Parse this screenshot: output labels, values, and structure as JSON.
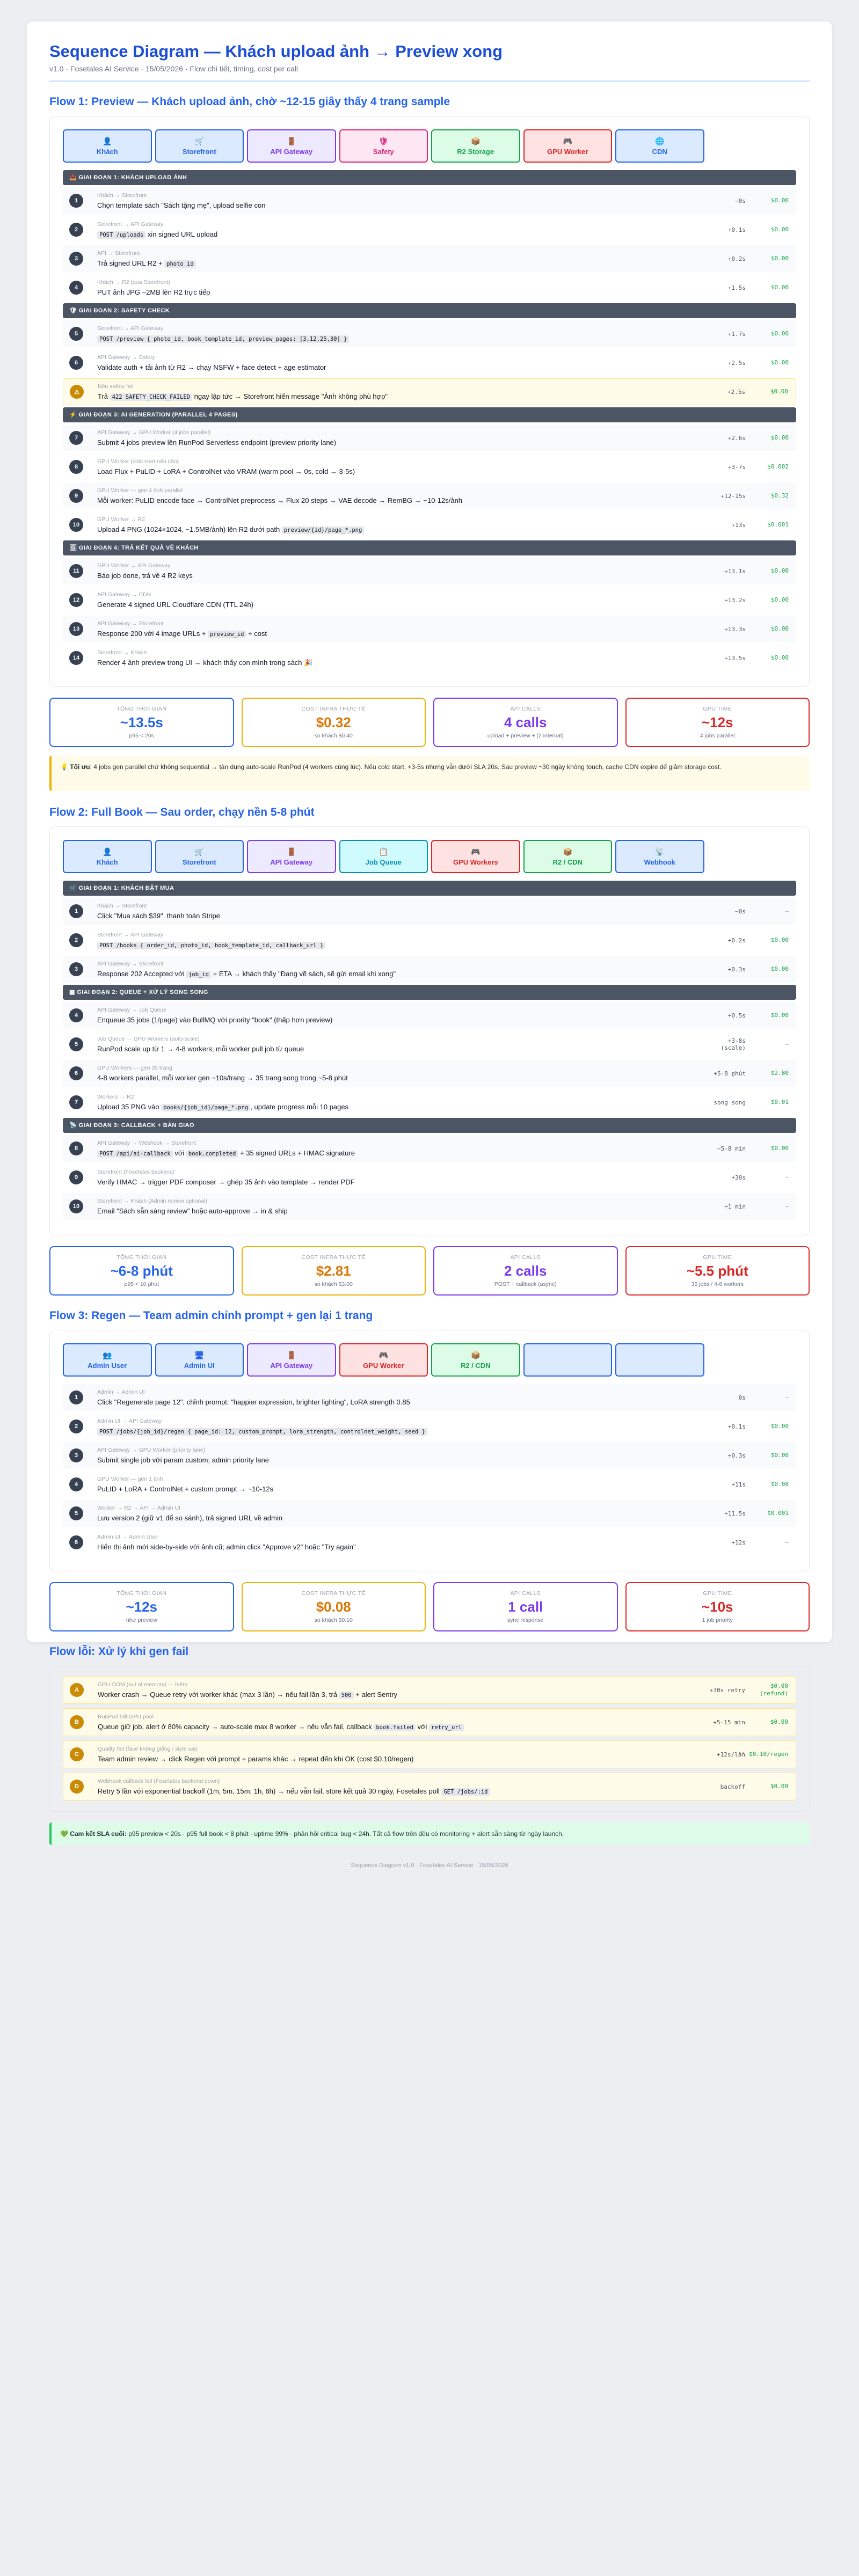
{
  "header": {
    "title": "Sequence Diagram — Khách upload ảnh → Preview xong",
    "meta": "v1.0 · Fosetales AI Service · 15/05/2026 · Flow chi tiết, timing, cost per call"
  },
  "colors": {
    "blue": "#2563eb",
    "lightblue": "#dbeafe",
    "purple": "#7c3aed",
    "lightpurple": "#ede9fe",
    "pink": "#db2777",
    "lightpink": "#fce7f3",
    "green": "#16a34a",
    "lightgreen": "#dcfce7",
    "red": "#dc2626",
    "lightred": "#fee2e2",
    "cyan": "#0891b2",
    "lightcyan": "#cffafe",
    "orange": "#d97706"
  },
  "flows": [
    {
      "title": "Flow 1: Preview — Khách upload ảnh, chờ ~12-15 giây thấy 4 trang sample",
      "actors": [
        {
          "label": "Khách",
          "icon": "👤",
          "color": "blue"
        },
        {
          "label": "Storefront",
          "icon": "🛒",
          "color": "blue"
        },
        {
          "label": "API Gateway",
          "icon": "🚪",
          "color": "purple"
        },
        {
          "label": "Safety",
          "icon": "🛡",
          "color": "pink"
        },
        {
          "label": "R2 Storage",
          "icon": "📦",
          "color": "green"
        },
        {
          "label": "GPU Worker",
          "icon": "🎮",
          "color": "red"
        },
        {
          "label": "CDN",
          "icon": "🌐",
          "color": "blue"
        }
      ],
      "phases": [
        {
          "label": "📤 Giai đoạn 1: Khách upload ảnh",
          "steps": [
            {
              "n": "1",
              "from": "Khách → Storefront",
              "parts": [
                {
                  "t": "Chọn template sách \"Sách tặng mẹ\", upload selfie con"
                }
              ],
              "time": "~0s",
              "cost": "$0.00"
            },
            {
              "n": "2",
              "from": "Storefront → API Gateway",
              "parts": [
                {
                  "t": "POST /uploads",
                  "c": true
                },
                {
                  "t": " xin signed URL upload"
                }
              ],
              "time": "+0.1s",
              "cost": "$0.00"
            },
            {
              "n": "3",
              "from": "API → Storefront",
              "parts": [
                {
                  "t": "Trả signed URL R2 + "
                },
                {
                  "t": "photo_id",
                  "c": true
                }
              ],
              "time": "+0.2s",
              "cost": "$0.00"
            },
            {
              "n": "4",
              "from": "Khách → R2 (qua Storefront)",
              "parts": [
                {
                  "t": "PUT ảnh JPG ~2MB lên R2 trực tiếp"
                }
              ],
              "time": "+1.5s",
              "cost": "$0.00"
            }
          ]
        },
        {
          "label": "🛡 Giai đoạn 2: Safety check",
          "steps": [
            {
              "n": "5",
              "from": "Storefront → API Gateway",
              "parts": [
                {
                  "t": "POST /preview { photo_id, book_template_id, preview_pages: [3,12,25,30] }",
                  "c": true
                }
              ],
              "time": "+1.7s",
              "cost": "$0.00"
            },
            {
              "n": "6",
              "from": "API Gateway → Safety",
              "parts": [
                {
                  "t": "Validate auth + tải ảnh từ R2 → chạy NSFW + face detect + age estimator"
                }
              ],
              "time": "+2.5s",
              "cost": "$0.00"
            },
            {
              "n": "⚠",
              "warn": true,
              "from": "Nếu safety fail",
              "parts": [
                {
                  "t": "Trả "
                },
                {
                  "t": "422 SAFETY_CHECK_FAILED",
                  "c": true
                },
                {
                  "t": " ngay lập tức → Storefront hiển message \"Ảnh không phù hợp\""
                }
              ],
              "time": "+2.5s",
              "cost": "$0.00"
            }
          ]
        },
        {
          "label": "⚡ Giai đoạn 3: AI generation (parallel 4 pages)",
          "steps": [
            {
              "n": "7",
              "from": "API Gateway → GPU Worker (4 jobs parallel)",
              "parts": [
                {
                  "t": "Submit 4 jobs preview lên RunPod Serverless endpoint (preview priority lane)"
                }
              ],
              "time": "+2.6s",
              "cost": "$0.00"
            },
            {
              "n": "8",
              "from": "GPU Worker (cold start nếu cần)",
              "parts": [
                {
                  "t": "Load Flux + PuLID + LoRA + ControlNet vào VRAM (warm pool → 0s, cold → 3-5s)"
                }
              ],
              "time": "+3-7s",
              "cost": "$0.002"
            },
            {
              "n": "9",
              "from": "GPU Worker — gen 4 ảnh parallel",
              "parts": [
                {
                  "t": "Mỗi worker: PuLID encode face → ControlNet preprocess → Flux 20 steps → VAE decode → RemBG → ~10-12s/ảnh"
                }
              ],
              "time": "+12-15s",
              "cost": "$0.32"
            },
            {
              "n": "10",
              "from": "GPU Worker → R2",
              "parts": [
                {
                  "t": "Upload 4 PNG (1024×1024, ~1.5MB/ảnh) lên R2 dưới path "
                },
                {
                  "t": "preview/{id}/page_*.png",
                  "c": true
                }
              ],
              "time": "+13s",
              "cost": "$0.001"
            }
          ]
        },
        {
          "label": "🖼 Giai đoạn 4: Trả kết quả về khách",
          "steps": [
            {
              "n": "11",
              "from": "GPU Worker → API Gateway",
              "parts": [
                {
                  "t": "Báo job done, trả về 4 R2 keys"
                }
              ],
              "time": "+13.1s",
              "cost": "$0.00"
            },
            {
              "n": "12",
              "from": "API Gateway → CDN",
              "parts": [
                {
                  "t": "Generate 4 signed URL Cloudflare CDN (TTL 24h)"
                }
              ],
              "time": "+13.2s",
              "cost": "$0.00"
            },
            {
              "n": "13",
              "from": "API Gateway → Storefront",
              "parts": [
                {
                  "t": "Response 200 với 4 image URLs + "
                },
                {
                  "t": "preview_id",
                  "c": true
                },
                {
                  "t": " + cost"
                }
              ],
              "time": "+13.3s",
              "cost": "$0.00"
            },
            {
              "n": "14",
              "from": "Storefront → Khách",
              "parts": [
                {
                  "t": "Render 4 ảnh preview trong UI → khách thấy con mình trong sách 🎉"
                }
              ],
              "time": "+13.5s",
              "cost": "$0.00"
            }
          ]
        }
      ],
      "metrics": [
        {
          "label": "Tổng thời gian",
          "value": "~13.5s",
          "sub": "p95 < 20s",
          "color": "blue"
        },
        {
          "label": "Cost infra thực tế",
          "value": "$0.32",
          "sub": "so khách $0.40",
          "color": "orange"
        },
        {
          "label": "API calls",
          "value": "4 calls",
          "sub": "upload + preview + (2 internal)",
          "color": "purple"
        },
        {
          "label": "GPU time",
          "value": "~12s",
          "sub": "4 jobs parallel",
          "color": "red"
        }
      ],
      "note": {
        "lead": "💡 Tối ưu",
        "text": ": 4 jobs gen parallel chứ không sequential → tận dụng auto-scale RunPod (4 workers cùng lúc). Nếu cold start, +3-5s nhưng vẫn dưới SLA 20s. Sau preview ~30 ngày không touch, cache CDN expire để giảm storage cost."
      }
    },
    {
      "title": "Flow 2: Full Book — Sau order, chạy nền 5-8 phút",
      "actors": [
        {
          "label": "Khách",
          "icon": "👤",
          "color": "blue"
        },
        {
          "label": "Storefront",
          "icon": "🛒",
          "color": "blue"
        },
        {
          "label": "API Gateway",
          "icon": "🚪",
          "color": "purple"
        },
        {
          "label": "Job Queue",
          "icon": "📋",
          "color": "cyan"
        },
        {
          "label": "GPU Workers",
          "icon": "🎮",
          "color": "red"
        },
        {
          "label": "R2 / CDN",
          "icon": "📦",
          "color": "green"
        },
        {
          "label": "Webhook",
          "icon": "📡",
          "color": "blue"
        }
      ],
      "phases": [
        {
          "label": "🛒 Giai đoạn 1: Khách đặt mua",
          "steps": [
            {
              "n": "1",
              "from": "Khách → Storefront",
              "parts": [
                {
                  "t": "Click \"Mua sách $39\", thanh toán Stripe"
                }
              ],
              "time": "~0s",
              "cost": "—"
            },
            {
              "n": "2",
              "from": "Storefront → API Gateway",
              "parts": [
                {
                  "t": "POST /books { order_id, photo_id, book_template_id, callback_url }",
                  "c": true
                }
              ],
              "time": "+0.2s",
              "cost": "$0.00"
            },
            {
              "n": "3",
              "from": "API Gateway → Storefront",
              "parts": [
                {
                  "t": "Response 202 Accepted với "
                },
                {
                  "t": "job_id",
                  "c": true
                },
                {
                  "t": " + ETA → khách thấy \"Đang vẽ sách, sẽ gửi email khi xong\""
                }
              ],
              "time": "+0.3s",
              "cost": "$0.00"
            }
          ]
        },
        {
          "label": "▦ Giai đoạn 2: Queue + xử lý song song",
          "steps": [
            {
              "n": "4",
              "from": "API Gateway → Job Queue",
              "parts": [
                {
                  "t": "Enqueue 35 jobs (1/page) vào BullMQ với priority \"book\" (thấp hơn preview)"
                }
              ],
              "time": "+0.5s",
              "cost": "$0.00"
            },
            {
              "n": "5",
              "from": "Job Queue → GPU Workers (auto-scale)",
              "parts": [
                {
                  "t": "RunPod scale up từ 1 → 4-8 workers; mỗi worker pull job từ queue"
                }
              ],
              "time": "+3-8s\n(scale)",
              "cost": "—"
            },
            {
              "n": "6",
              "from": "GPU Workers — gen 35 trang",
              "parts": [
                {
                  "t": "4-8 workers parallel, mỗi worker gen ~10s/trang → 35 trang song trong ~5-8 phút"
                }
              ],
              "time": "+5-8 phút",
              "cost": "$2.80"
            },
            {
              "n": "7",
              "from": "Workers → R2",
              "parts": [
                {
                  "t": "Upload 35 PNG vào "
                },
                {
                  "t": "books/{job_id}/page_*.png",
                  "c": true
                },
                {
                  "t": ", update progress mỗi 10 pages"
                }
              ],
              "time": "song song",
              "cost": "$0.01"
            }
          ]
        },
        {
          "label": "📡 Giai đoạn 3: Callback + bàn giao",
          "steps": [
            {
              "n": "8",
              "from": "API Gateway → Webhook → Storefront",
              "parts": [
                {
                  "t": "POST /api/ai-callback",
                  "c": true
                },
                {
                  "t": " với "
                },
                {
                  "t": "book.completed",
                  "c": true
                },
                {
                  "t": " + 35 signed URLs + HMAC signature"
                }
              ],
              "time": "~5-8 min",
              "cost": "$0.00"
            },
            {
              "n": "9",
              "from": "Storefront (Fosetales backend)",
              "parts": [
                {
                  "t": "Verify HMAC → trigger PDF composer → ghép 35 ảnh vào template → render PDF"
                }
              ],
              "time": "+30s",
              "cost": "—"
            },
            {
              "n": "10",
              "from": "Storefront → Khách (Admin review optional)",
              "parts": [
                {
                  "t": "Email \"Sách sẵn sàng review\" hoặc auto-approve → in & ship"
                }
              ],
              "time": "+1 min",
              "cost": "—"
            }
          ]
        }
      ],
      "metrics": [
        {
          "label": "Tổng thời gian",
          "value": "~6-8 phút",
          "sub": "p95 < 10 phút",
          "color": "blue"
        },
        {
          "label": "Cost infra thực tế",
          "value": "$2.81",
          "sub": "so khách $3.00",
          "color": "orange"
        },
        {
          "label": "API calls",
          "value": "2 calls",
          "sub": "POST + callback (async)",
          "color": "purple"
        },
        {
          "label": "GPU time",
          "value": "~5.5 phút",
          "sub": "35 jobs / 4-8 workers",
          "color": "red"
        }
      ]
    },
    {
      "title": "Flow 3: Regen — Team admin chỉnh prompt + gen lại 1 trang",
      "actors": [
        {
          "label": "Admin User",
          "icon": "👥",
          "color": "blue"
        },
        {
          "label": "Admin UI",
          "icon": "🖥",
          "color": "blue"
        },
        {
          "label": "API Gateway",
          "icon": "🚪",
          "color": "purple"
        },
        {
          "label": "GPU Worker",
          "icon": "🎮",
          "color": "red"
        },
        {
          "label": "R2 / CDN",
          "icon": "📦",
          "color": "green"
        },
        {
          "label": "",
          "icon": "",
          "color": "blue"
        },
        {
          "label": "",
          "icon": "",
          "color": "blue"
        }
      ],
      "phases": [
        {
          "label": "",
          "steps": [
            {
              "n": "1",
              "from": "Admin → Admin UI",
              "parts": [
                {
                  "t": "Click \"Regenerate page 12\", chỉnh prompt: \"happier expression, brighter lighting\", LoRA strength 0.85"
                }
              ],
              "time": "0s",
              "cost": "—"
            },
            {
              "n": "2",
              "from": "Admin UI → API Gateway",
              "parts": [
                {
                  "t": "POST /jobs/{job_id}/regen { page_id: 12, custom_prompt, lora_strength, controlnet_weight, seed }",
                  "c": true
                }
              ],
              "time": "+0.1s",
              "cost": "$0.00"
            },
            {
              "n": "3",
              "from": "API Gateway → GPU Worker (priority lane)",
              "parts": [
                {
                  "t": "Submit single job với param custom; admin priority lane"
                }
              ],
              "time": "+0.3s",
              "cost": "$0.00"
            },
            {
              "n": "4",
              "from": "GPU Worker — gen 1 ảnh",
              "parts": [
                {
                  "t": "PuLID + LoRA + ControlNet + custom prompt → ~10-12s"
                }
              ],
              "time": "+11s",
              "cost": "$0.08"
            },
            {
              "n": "5",
              "from": "Worker → R2 → API → Admin UI",
              "parts": [
                {
                  "t": "Lưu version 2 (giữ v1 để so sánh), trả signed URL về admin"
                }
              ],
              "time": "+11.5s",
              "cost": "$0.001"
            },
            {
              "n": "6",
              "from": "Admin UI → Admin User",
              "parts": [
                {
                  "t": "Hiển thị ảnh mới side-by-side với ảnh cũ; admin click \"Approve v2\" hoặc \"Try again\""
                }
              ],
              "time": "+12s",
              "cost": "—"
            }
          ]
        }
      ],
      "metrics": [
        {
          "label": "Tổng thời gian",
          "value": "~12s",
          "sub": "như preview",
          "color": "blue"
        },
        {
          "label": "Cost infra thực tế",
          "value": "$0.08",
          "sub": "so khách $0.10",
          "color": "orange"
        },
        {
          "label": "API calls",
          "value": "1 call",
          "sub": "sync response",
          "color": "purple"
        },
        {
          "label": "GPU time",
          "value": "~10s",
          "sub": "1 job priority",
          "color": "red"
        }
      ]
    }
  ],
  "errors": {
    "title": "Flow lỗi: Xử lý khi gen fail",
    "items": [
      {
        "n": "A",
        "from": "GPU OOM (out of memory) — hiếm",
        "parts": [
          {
            "t": "Worker crash → Queue retry với worker khác (max 3 lần) → nếu fail lần 3, trả "
          },
          {
            "t": "500",
            "c": true
          },
          {
            "t": " + alert Sentry"
          }
        ],
        "time": "+30s retry",
        "cost": "$0.00\n(refund)"
      },
      {
        "n": "B",
        "from": "RunPod hết GPU pool",
        "parts": [
          {
            "t": "Queue giữ job, alert ở 80% capacity → auto-scale max 8 worker → nếu vẫn fail, callback "
          },
          {
            "t": "book.failed",
            "c": true
          },
          {
            "t": " với "
          },
          {
            "t": "retry_url",
            "c": true
          }
        ],
        "time": "+5-15 min",
        "cost": "$0.00"
      },
      {
        "n": "C",
        "from": "Quality fail (face không giống / style sai)",
        "parts": [
          {
            "t": "Team admin review → click Regen với prompt + params khác → repeat đến khi OK (cost $0.10/regen)"
          }
        ],
        "time": "+12s/lần",
        "cost": "$0.10/regen"
      },
      {
        "n": "D",
        "from": "Webhook callback fail (Fosetales backend down)",
        "parts": [
          {
            "t": "Retry 5 lần với exponential backoff (1m, 5m, 15m, 1h, 6h) → nếu vẫn fail, store kết quả 30 ngày, Fosetales poll "
          },
          {
            "t": "GET /jobs/:id",
            "c": true
          }
        ],
        "time": "backoff",
        "cost": "$0.00"
      }
    ]
  },
  "summary": {
    "lead": "💚 Cam kết SLA cuối:",
    "text": " p95 preview < 20s · p95 full book < 8 phút · uptime 99% · phản hồi critical bug < 24h. Tất cả flow trên đều có monitoring + alert sẵn sàng từ ngày launch."
  },
  "footer": "Sequence Diagram v1.0 · Fosetales AI Service · 15/05/2026"
}
